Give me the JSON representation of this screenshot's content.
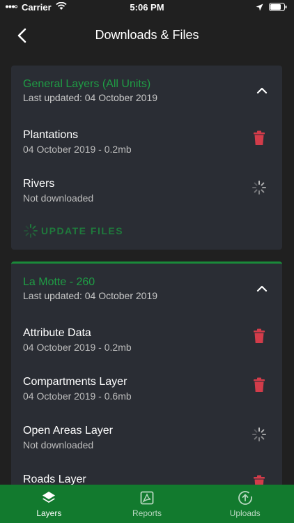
{
  "status_bar": {
    "carrier": "Carrier",
    "time": "5:06 PM"
  },
  "nav": {
    "title": "Downloads & Files"
  },
  "colors": {
    "accent": "#1f9d45",
    "danger": "#d23c4a",
    "tabbar": "#127a2e",
    "card": "#2a2d34",
    "background": "#202020"
  },
  "sections": [
    {
      "title": "General Layers (All Units)",
      "subtitle": "Last updated: 04 October 2019",
      "files": [
        {
          "name": "Plantations",
          "meta": "04 October 2019 - 0.2mb",
          "status": "downloaded"
        },
        {
          "name": "Rivers",
          "meta": "Not downloaded",
          "status": "loading"
        }
      ],
      "update_label": "UPDATE FILES"
    },
    {
      "title": "La Motte - 260",
      "subtitle": "Last updated: 04 October 2019",
      "files": [
        {
          "name": "Attribute Data",
          "meta": "04 October 2019 - 0.2mb",
          "status": "downloaded"
        },
        {
          "name": "Compartments Layer",
          "meta": "04 October 2019 - 0.6mb",
          "status": "downloaded"
        },
        {
          "name": "Open Areas Layer",
          "meta": "Not downloaded",
          "status": "loading"
        },
        {
          "name": "Roads Layer",
          "meta": "",
          "status": "downloaded"
        }
      ]
    }
  ],
  "tabs": [
    {
      "label": "Layers",
      "icon": "layers-icon",
      "active": true
    },
    {
      "label": "Reports",
      "icon": "pdf-icon",
      "active": false
    },
    {
      "label": "Uploads",
      "icon": "upload-icon",
      "active": false
    }
  ]
}
